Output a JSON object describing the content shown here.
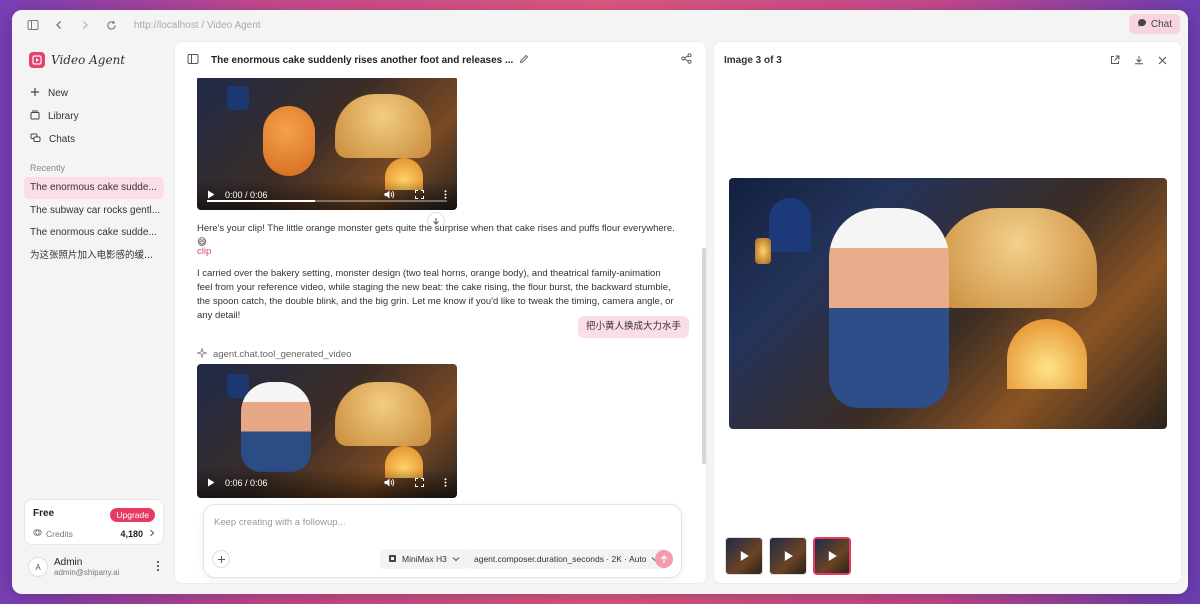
{
  "browser": {
    "url_prefix": "http://",
    "url_host": "localhost",
    "url_path": " / Video Agent",
    "chat_button": "Chat"
  },
  "sidebar": {
    "brand": "Video Agent",
    "nav": [
      {
        "label": "New",
        "icon": "plus-icon"
      },
      {
        "label": "Library",
        "icon": "library-icon"
      },
      {
        "label": "Chats",
        "icon": "chats-icon"
      }
    ],
    "recent_title": "Recently",
    "recent": [
      "The enormous cake sudde...",
      "The subway car rocks gentl...",
      "The enormous cake sudde...",
      "为这张照片加入电影感的缓..."
    ],
    "plan": {
      "name": "Free",
      "upgrade": "Upgrade",
      "credits_label": "Credits",
      "credits_value": "4,180"
    },
    "user": {
      "initial": "A",
      "name": "Admin",
      "email": "admin@shipany.ai"
    }
  },
  "chat": {
    "title": "The enormous cake suddenly rises another foot and releases ...",
    "video1": {
      "time": "0:00 / 0:06",
      "progress": 0.45
    },
    "message1": "Here's your clip! The little orange monster gets quite the surprise when that cake rises and puffs flour everywhere. 😄",
    "clip_link": "clip",
    "message2": "I carried over the bakery setting, monster design (two teal horns, orange body), and theatrical family-animation feel from your reference video, while staging the new beat: the cake rising, the flour burst, the backward stumble, the spoon catch, the double blink, and the big grin. Let me know if you'd like to tweak the timing, camera angle, or any detail!",
    "user_message": "把小黄人换成大力水手",
    "tool_label": "agent.chat.tool_generated_video",
    "video2": {
      "time": "0:06 / 0:06",
      "progress": 1.0
    },
    "composer": {
      "placeholder": "Keep creating with a followup...",
      "model": "MiniMax H3",
      "duration": "agent.composer.duration_seconds · 2K · Auto"
    }
  },
  "viewer": {
    "title": "Image 3 of 3",
    "thumbnails": [
      {
        "active": false,
        "type": "video"
      },
      {
        "active": false,
        "type": "video"
      },
      {
        "active": true,
        "type": "video"
      }
    ]
  },
  "colors": {
    "accent": "#e63a63",
    "accent_light": "#fbdde6"
  }
}
